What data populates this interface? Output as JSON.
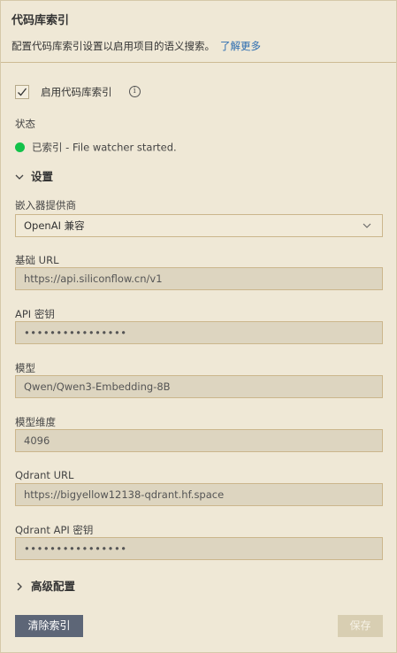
{
  "header": {
    "title": "代码库索引",
    "description": "配置代码库索引设置以启用项目的语义搜索。",
    "learn_more": "了解更多"
  },
  "enable": {
    "label": "启用代码库索引",
    "checked": true,
    "info_icon": "info-icon"
  },
  "status": {
    "label": "状态",
    "indicator_color": "#13c24a",
    "text": "已索引 - File watcher started."
  },
  "settings": {
    "title": "设置",
    "expanded": true,
    "embedder": {
      "label": "嵌入器提供商",
      "value": "OpenAI 兼容"
    },
    "base_url": {
      "label": "基础 URL",
      "value": "https://api.siliconflow.cn/v1"
    },
    "api_key": {
      "label": "API 密钥",
      "value": "••••••••••••••••"
    },
    "model": {
      "label": "模型",
      "value": "Qwen/Qwen3-Embedding-8B"
    },
    "dimension": {
      "label": "模型维度",
      "value": "4096"
    },
    "qdrant_url": {
      "label": "Qdrant URL",
      "value": "https://bigyellow12138-qdrant.hf.space"
    },
    "qdrant_key": {
      "label": "Qdrant API 密钥",
      "value": "••••••••••••••••"
    }
  },
  "advanced": {
    "title": "高级配置",
    "expanded": false
  },
  "actions": {
    "clear": "清除索引",
    "save": "保存"
  },
  "colors": {
    "background": "#efe8d6",
    "link": "#2b6cb0",
    "clear_button": "#5d6677",
    "save_button_disabled": "#d8ceb2",
    "input_border": "#cbb68c"
  }
}
